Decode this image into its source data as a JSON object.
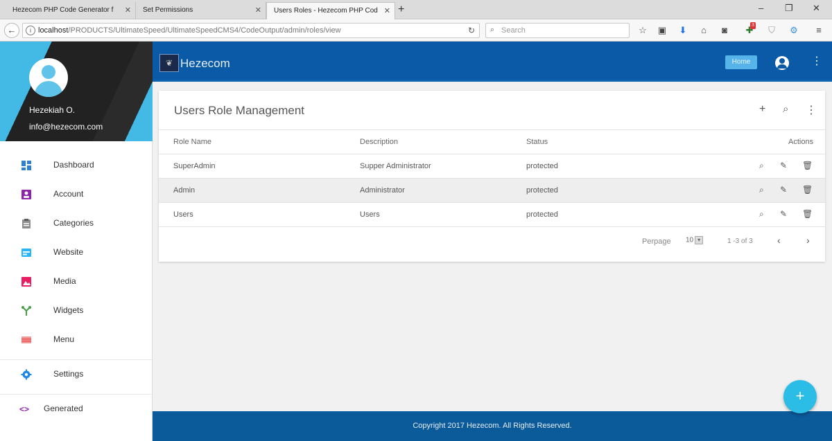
{
  "browser": {
    "tabs": [
      {
        "title": "Hezecom PHP Code Generator f"
      },
      {
        "title": "Set Permissions"
      },
      {
        "title": "Users Roles - Hezecom PHP Cod"
      }
    ],
    "url_prefix": "localhost",
    "url_rest": "/PRODUCTS/UltimateSpeed/UltimateSpeedCMS4/CodeOutput/admin/roles/view",
    "search_placeholder": "Search",
    "notification_count": "3"
  },
  "sidebar": {
    "user_name": "Hezekiah O.",
    "user_email": "info@hezecom.com",
    "items": [
      {
        "label": "Dashboard",
        "icon": "dashboard-icon",
        "color": "#2f80d3"
      },
      {
        "label": "Account",
        "icon": "account-icon",
        "color": "#8e24aa"
      },
      {
        "label": "Categories",
        "icon": "clipboard-icon",
        "color": "#8d8d8d"
      },
      {
        "label": "Website",
        "icon": "web-icon",
        "color": "#29b6f6"
      },
      {
        "label": "Media",
        "icon": "image-icon",
        "color": "#e91e63"
      },
      {
        "label": "Widgets",
        "icon": "widgets-icon",
        "color": "#43a047"
      },
      {
        "label": "Menu",
        "icon": "menu-icon",
        "color": "#ef5350"
      },
      {
        "label": "Settings",
        "icon": "gear-icon",
        "color": "#1e88e5"
      },
      {
        "label": "Generated",
        "icon": "code-icon",
        "color": "#8e24aa"
      }
    ]
  },
  "header": {
    "app_name": "Hezecom",
    "home_label": "Home"
  },
  "main": {
    "title": "Users Role Management",
    "columns": [
      "Role Name",
      "Description",
      "Status",
      "Actions"
    ],
    "rows": [
      {
        "name": "SuperAdmin",
        "description": "Supper Administrator",
        "status": "protected"
      },
      {
        "name": "Admin",
        "description": "Administrator",
        "status": "protected"
      },
      {
        "name": "Users",
        "description": "Users",
        "status": "protected"
      }
    ],
    "pagination": {
      "perpage_label": "Perpage",
      "perpage_value": "10",
      "range": "1 -3 of 3"
    }
  },
  "footer": {
    "text": "Copyright 2017 Hezecom. All Rights Reserved."
  },
  "colors": {
    "appbar": "#0a5aa7",
    "footer": "#0b5a9a",
    "fab": "#2bbde6",
    "home_button": "#56b4ea"
  }
}
